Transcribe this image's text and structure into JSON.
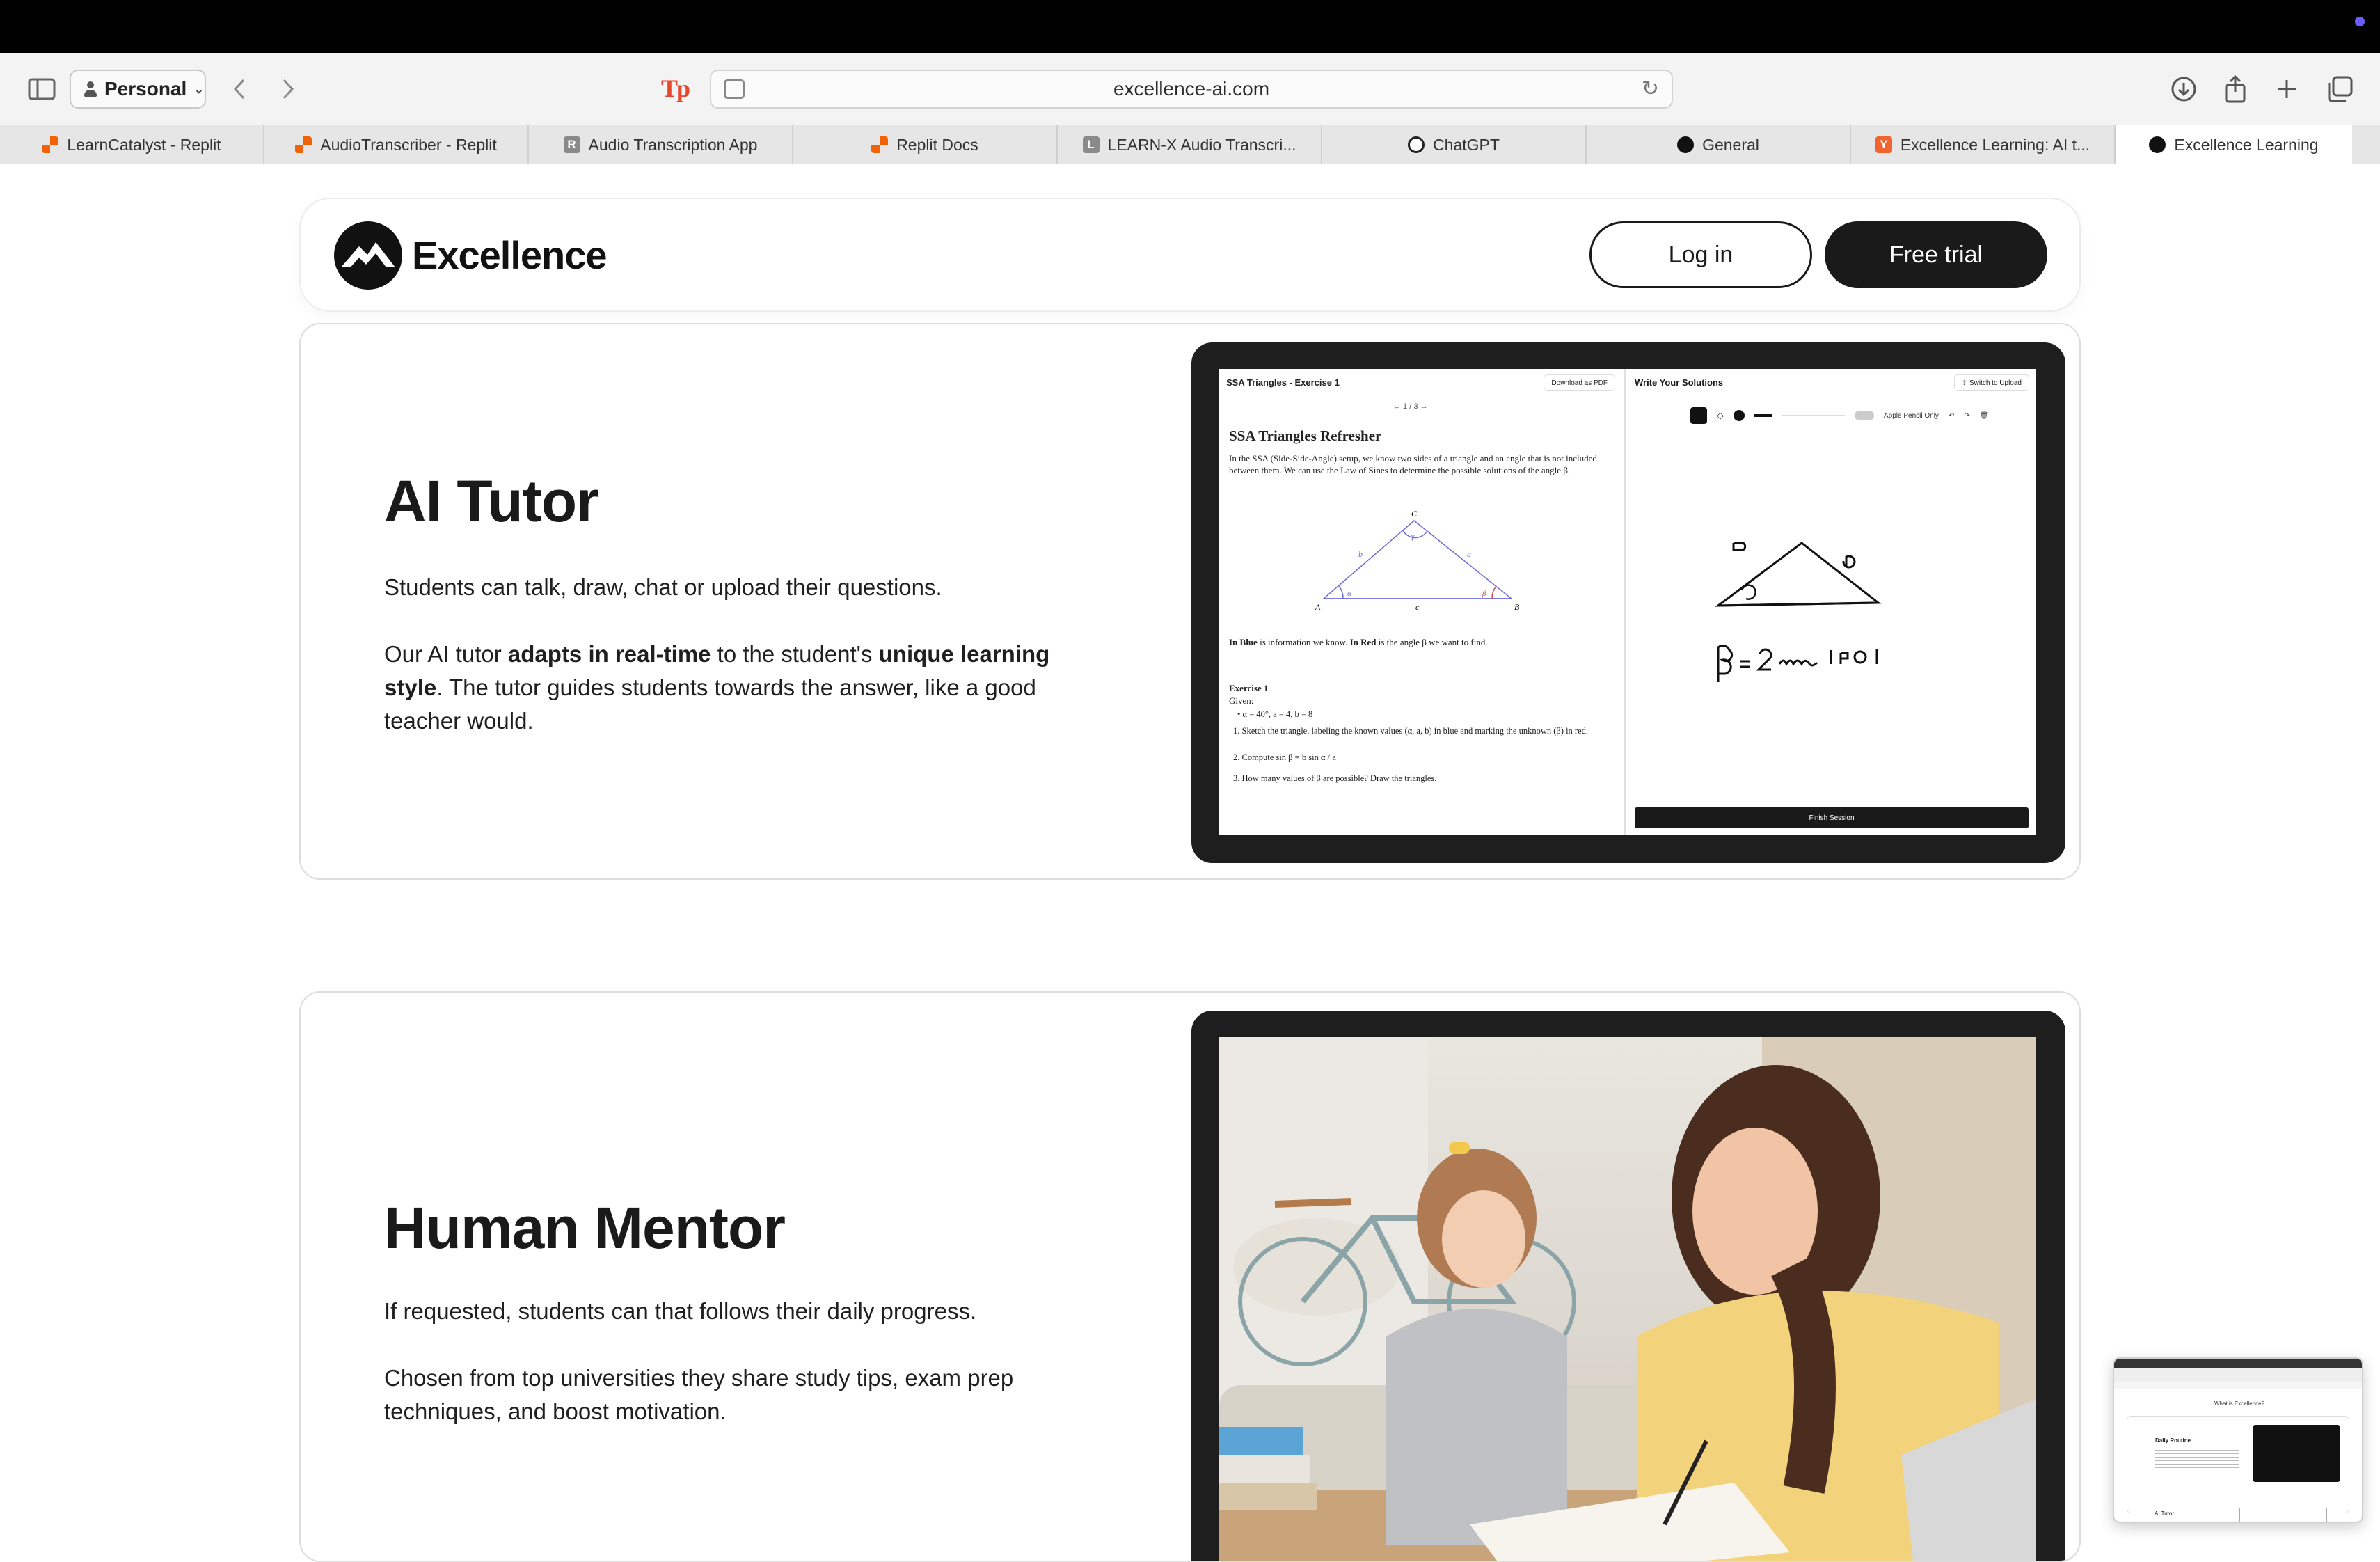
{
  "browser": {
    "profile_label": "Personal",
    "url": "excellence-ai.com",
    "extension_label": "Tp",
    "tabs": [
      {
        "label": "LearnCatalyst - Replit",
        "favicon": "replit-icon"
      },
      {
        "label": "AudioTranscriber - Replit",
        "favicon": "replit-icon"
      },
      {
        "label": "Audio Transcription App",
        "favicon": "r-icon"
      },
      {
        "label": "Replit Docs",
        "favicon": "replit-icon"
      },
      {
        "label": "LEARN-X Audio Transcri...",
        "favicon": "l-icon"
      },
      {
        "label": "ChatGPT",
        "favicon": "chatgpt-icon"
      },
      {
        "label": "General",
        "favicon": "github-icon"
      },
      {
        "label": "Excellence Learning: AI t...",
        "favicon": "y-icon"
      },
      {
        "label": "Excellence Learning",
        "favicon": "excellence-icon",
        "active": true
      }
    ],
    "tab_favicon_letters": {
      "r": "R",
      "l": "L",
      "y": "Y"
    }
  },
  "header": {
    "brand": "Excellence",
    "login_label": "Log in",
    "trial_label": "Free trial"
  },
  "ai_tutor": {
    "title": "AI Tutor",
    "para1": "Students can talk, draw, chat or upload their questions.",
    "para2_a": "Our AI tutor ",
    "para2_b": "adapts in real-time",
    "para2_c": " to the student's ",
    "para2_d": "unique learning style",
    "para2_e": ". The tutor guides students towards the answer, like a good teacher would.",
    "screen": {
      "left_title": "SSA Triangles - Exercise 1",
      "download_label": "Download as PDF",
      "pager": "← 1 / 3 →",
      "doc_heading": "SSA Triangles Refresher",
      "doc_intro": "In the SSA (Side-Side-Angle) setup, we know two sides of a triangle and an angle that is not included between them. We can use the Law of Sines to determine the possible solutions of the angle β.",
      "legend_a": "In Blue",
      "legend_b": " is information we know. ",
      "legend_c": "In Red",
      "legend_d": " is the angle β we want to find.",
      "exercise_title": "Exercise 1",
      "given_label": "Given:",
      "given_values": "α = 40°, a = 4, b = 8",
      "steps": [
        "1. Sketch the triangle, labeling the known values (α, a, b) in blue and marking the unknown (β) in red.",
        "2. Compute sin β = b sin α / a",
        "3. How many values of β are possible? Draw the triangles."
      ],
      "right_title": "Write Your Solutions",
      "switch_label": "Switch to Upload",
      "pencil_label": "Apple Pencil Only",
      "finish_label": "Finish Session",
      "triangle_labels": {
        "top": "C",
        "left": "A",
        "right": "B",
        "side_left": "b",
        "side_right": "a",
        "side_bottom": "c",
        "angle_alpha": "α",
        "angle_beta": "β",
        "angle_gamma": "γ"
      }
    }
  },
  "human_mentor": {
    "title": "Human Mentor",
    "para1": "If requested, students can that follows their daily progress.",
    "para2": "Chosen from top universities they share study tips, exam prep techniques, and boost motivation."
  },
  "thumbnail": {
    "heading": "What is Excellence?",
    "section": "Daily Routine",
    "footer": "AI Tutor"
  },
  "colors": {
    "accent_dark": "#1a1a1a",
    "replit_orange": "#f26207",
    "triangle_blue": "#6b6bd6",
    "triangle_red": "#d94a4a"
  }
}
